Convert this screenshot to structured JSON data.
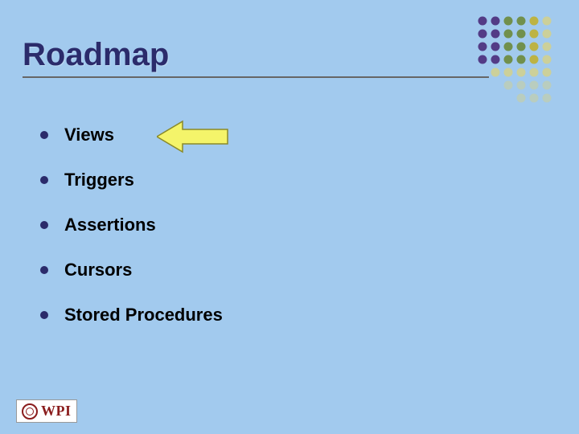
{
  "title": "Roadmap",
  "bullets": [
    {
      "label": "Views"
    },
    {
      "label": "Triggers"
    },
    {
      "label": "Assertions"
    },
    {
      "label": "Cursors"
    },
    {
      "label": "Stored Procedures"
    }
  ],
  "current_index": 0,
  "logo_text": "WPI",
  "colors": {
    "background": "#a2caee",
    "title": "#2b2b6b",
    "bullet": "#2b2b6b",
    "arrow_fill": "#f4f46a",
    "arrow_stroke": "#8a8a2a",
    "logo": "#8a1c1c"
  },
  "decoration_dots": {
    "cols": 6,
    "rows": 7,
    "colors": [
      "#4a2b7a",
      "#4a2b7a",
      "#6b8a3a",
      "#6b8a3a",
      "#c0b030",
      "#d0d090"
    ]
  }
}
